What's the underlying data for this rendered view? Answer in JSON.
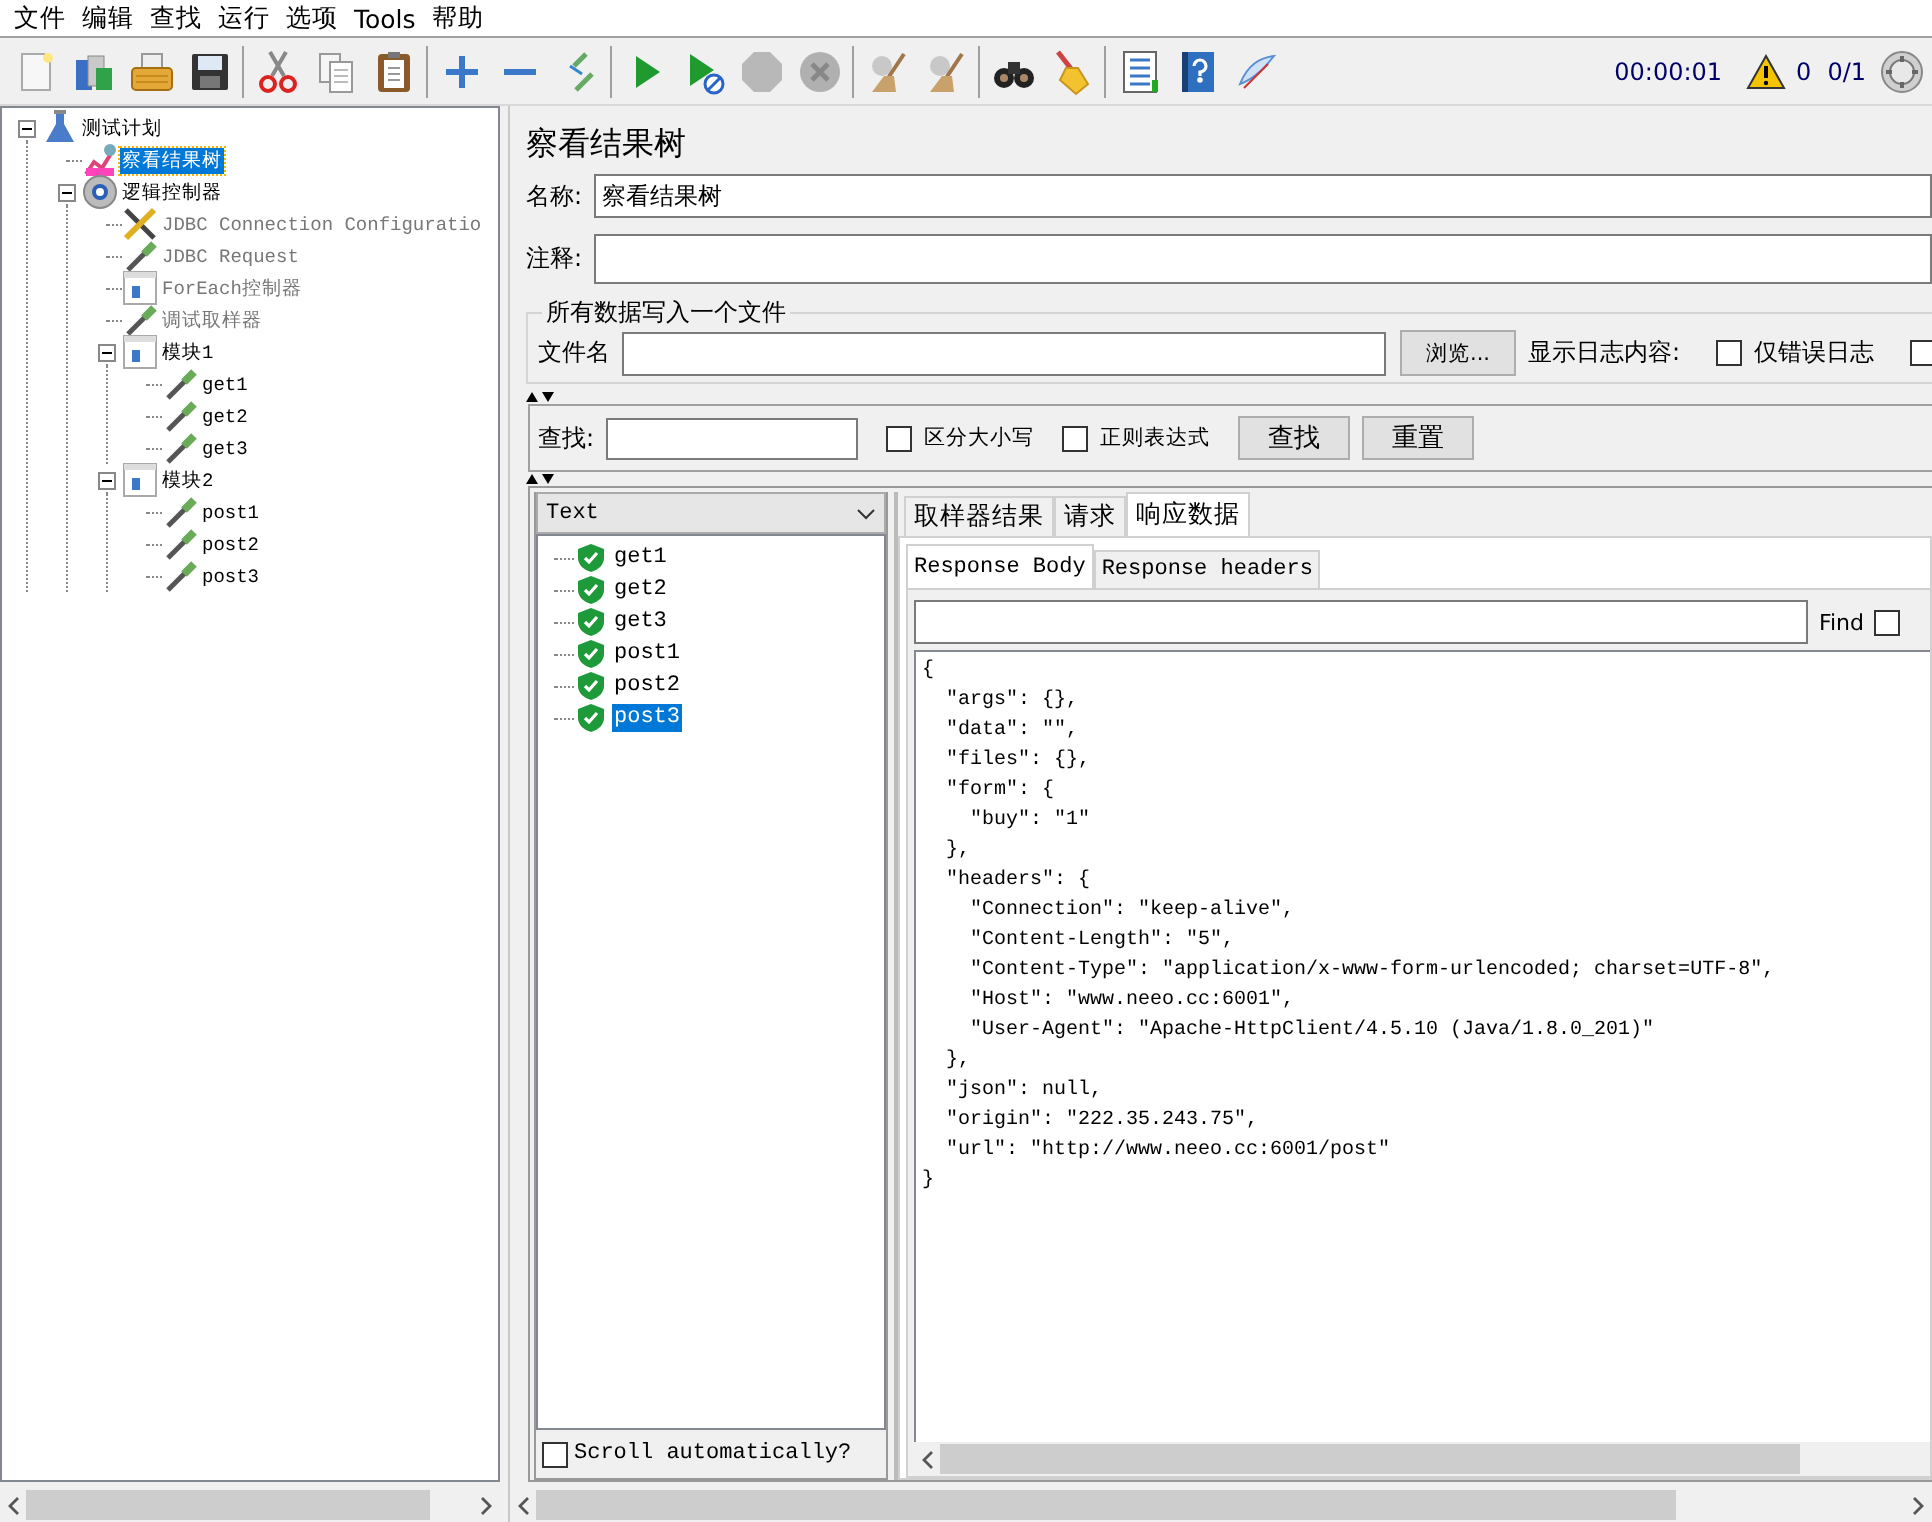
{
  "menu": [
    {
      "label": "文件"
    },
    {
      "label": "编辑"
    },
    {
      "label": "查找"
    },
    {
      "label": "运行"
    },
    {
      "label": "选项"
    },
    {
      "label": "Tools"
    },
    {
      "label": "帮助"
    }
  ],
  "status": {
    "elapsed": "00:00:01",
    "errors": "0",
    "threads": "0/1"
  },
  "tree": [
    {
      "label": "测试计划",
      "kind": "plan",
      "expanded": true,
      "selected": false,
      "disabled": false,
      "children": [
        {
          "label": "察看结果树",
          "kind": "listener",
          "selected": true,
          "disabled": false
        },
        {
          "label": "逻辑控制器",
          "kind": "controller",
          "expanded": true,
          "selected": false,
          "disabled": false,
          "children": [
            {
              "label": "JDBC Connection Configuratio",
              "kind": "config",
              "selected": false,
              "disabled": true
            },
            {
              "label": "JDBC Request",
              "kind": "sampler",
              "selected": false,
              "disabled": true
            },
            {
              "label": "ForEach控制器",
              "kind": "module",
              "selected": false,
              "disabled": true
            },
            {
              "label": "调试取样器",
              "kind": "sampler",
              "selected": false,
              "disabled": true
            },
            {
              "label": "模块1",
              "kind": "module",
              "expanded": true,
              "selected": false,
              "disabled": false,
              "children": [
                {
                  "label": "get1",
                  "kind": "sampler",
                  "selected": false,
                  "disabled": false
                },
                {
                  "label": "get2",
                  "kind": "sampler",
                  "selected": false,
                  "disabled": false
                },
                {
                  "label": "get3",
                  "kind": "sampler",
                  "selected": false,
                  "disabled": false
                }
              ]
            },
            {
              "label": "模块2",
              "kind": "module",
              "expanded": true,
              "selected": false,
              "disabled": false,
              "children": [
                {
                  "label": "post1",
                  "kind": "sampler",
                  "selected": false,
                  "disabled": false
                },
                {
                  "label": "post2",
                  "kind": "sampler",
                  "selected": false,
                  "disabled": false
                },
                {
                  "label": "post3",
                  "kind": "sampler",
                  "selected": false,
                  "disabled": false
                }
              ]
            }
          ]
        }
      ]
    }
  ],
  "panel": {
    "title": "察看结果树",
    "name_label": "名称:",
    "name_value": "察看结果树",
    "comment_label": "注释:"
  },
  "file_group": {
    "legend": "所有数据写入一个文件",
    "file_label": "文件名",
    "browse_button": "浏览...",
    "log_label": "显示日志内容:",
    "options": [
      {
        "label": "仅错误日志",
        "checked": false
      },
      {
        "checked": false
      }
    ]
  },
  "search": {
    "label": "查找:",
    "options": [
      {
        "label": "区分大小写",
        "checked": false
      },
      {
        "label": "正则表达式",
        "checked": false
      }
    ],
    "buttons": [
      {
        "label": "查找"
      },
      {
        "label": "重置"
      }
    ]
  },
  "results": {
    "renderer": "Text",
    "items": [
      {
        "label": "get1",
        "selected": false
      },
      {
        "label": "get2",
        "selected": false
      },
      {
        "label": "get3",
        "selected": false
      },
      {
        "label": "post1",
        "selected": false
      },
      {
        "label": "post2",
        "selected": false
      },
      {
        "label": "post3",
        "selected": true
      }
    ],
    "scroll_auto": {
      "label": "Scroll automatically?",
      "checked": false
    }
  },
  "tabs": [
    {
      "label": "取样器结果",
      "selected": false
    },
    {
      "label": "请求",
      "selected": false
    },
    {
      "label": "响应数据",
      "selected": true
    }
  ],
  "subtabs": [
    {
      "label": "Response Body",
      "selected": true
    },
    {
      "label": "Response headers",
      "selected": false
    }
  ],
  "find": {
    "label": "Find",
    "checked": false
  },
  "response_body": "{\n  \"args\": {},\n  \"data\": \"\",\n  \"files\": {},\n  \"form\": {\n    \"buy\": \"1\"\n  },\n  \"headers\": {\n    \"Connection\": \"keep-alive\",\n    \"Content-Length\": \"5\",\n    \"Content-Type\": \"application/x-www-form-urlencoded; charset=UTF-8\",\n    \"Host\": \"www.neeo.cc:6001\",\n    \"User-Agent\": \"Apache-HttpClient/4.5.10 (Java/1.8.0_201)\"\n  },\n  \"json\": null,\n  \"origin\": \"222.35.243.75\",\n  \"url\": \"http://www.neeo.cc:6001/post\"\n}"
}
